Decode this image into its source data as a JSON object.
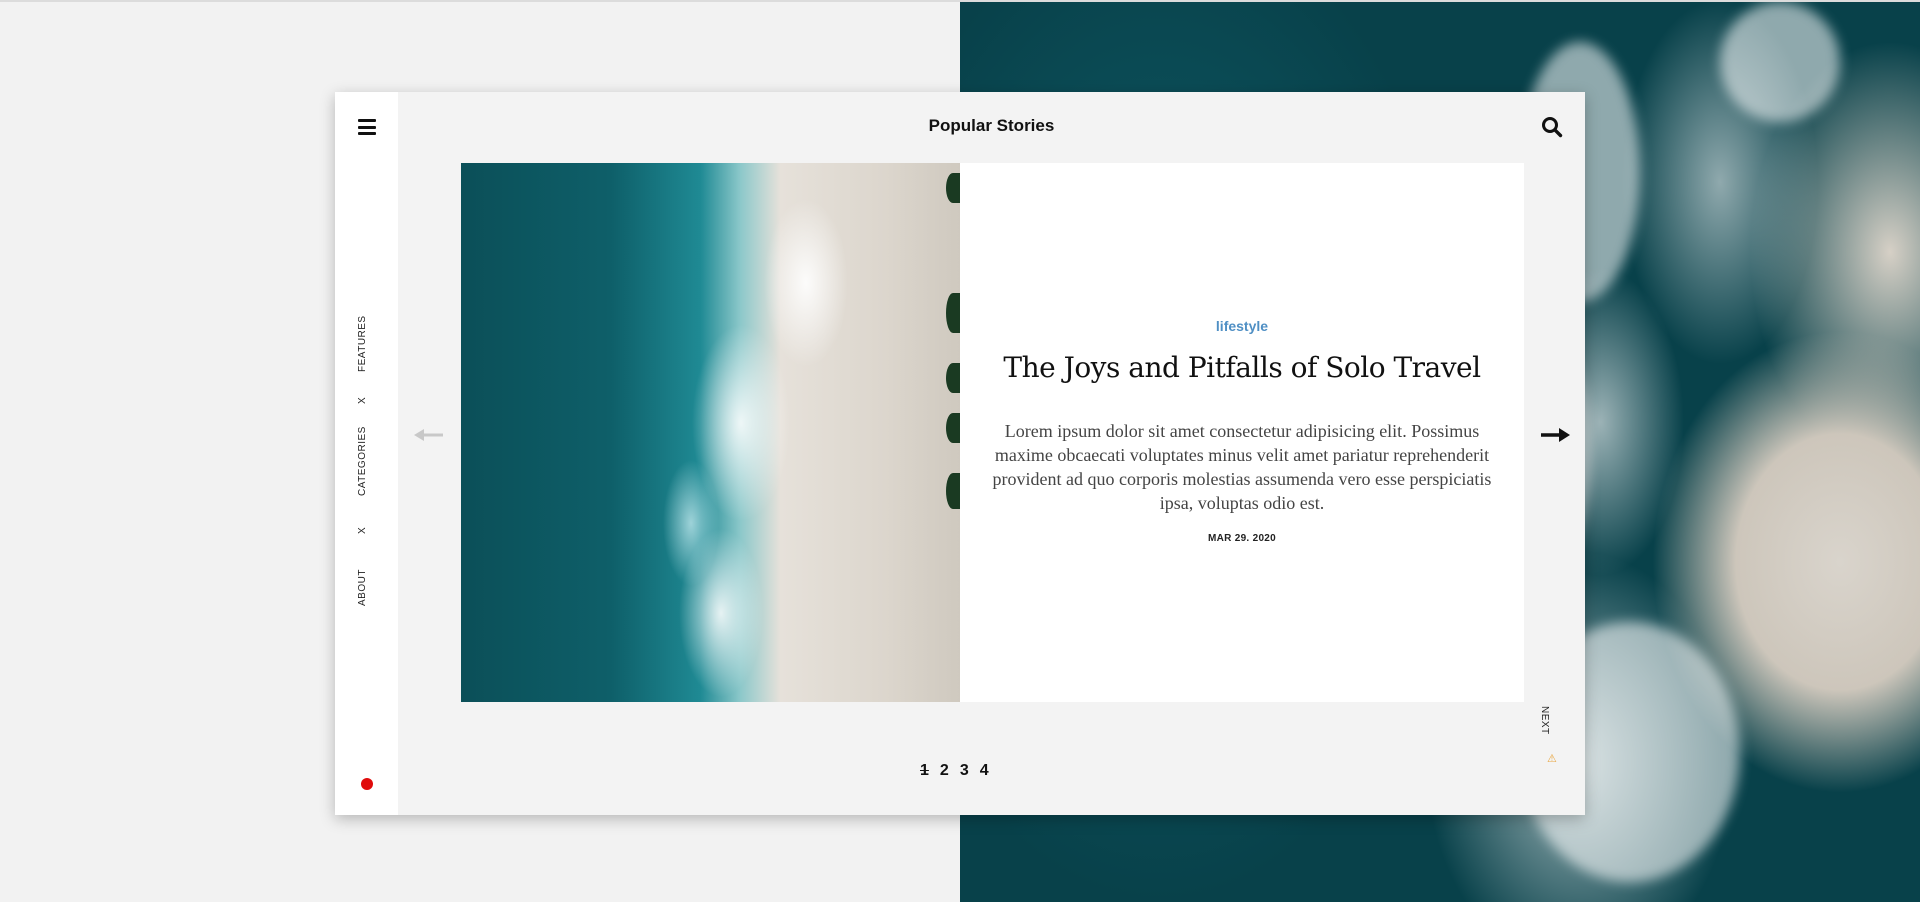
{
  "header": {
    "title": "Popular Stories"
  },
  "sidebar": {
    "items": [
      {
        "label": "FEATURES"
      },
      {
        "label": "X"
      },
      {
        "label": "CATEGORIES"
      },
      {
        "label": "X"
      },
      {
        "label": "ABOUT"
      }
    ]
  },
  "slide": {
    "category": "lifestyle",
    "title": "The Joys and Pitfalls of Solo Travel",
    "excerpt": "Lorem ipsum dolor sit amet consectetur adipisicing elit. Possimus maxime obcaecati voluptates minus velit amet pariatur reprehenderit provident ad quo corporis molestias assumenda vero esse perspiciatis ipsa, voluptas odio est.",
    "date": "MAR 29. 2020"
  },
  "nav": {
    "next_label": "NEXT"
  },
  "pagination": {
    "pages": [
      "1",
      "2",
      "3",
      "4"
    ],
    "current": "1"
  },
  "icons": {
    "menu": "hamburger-icon",
    "search": "search-icon",
    "prev": "arrow-left-icon",
    "next": "arrow-right-icon",
    "status": "red-dot-icon"
  },
  "colors": {
    "accent": "#4f8fc4",
    "status_dot": "#e00b0b",
    "card_bg": "#f3f3f3"
  }
}
